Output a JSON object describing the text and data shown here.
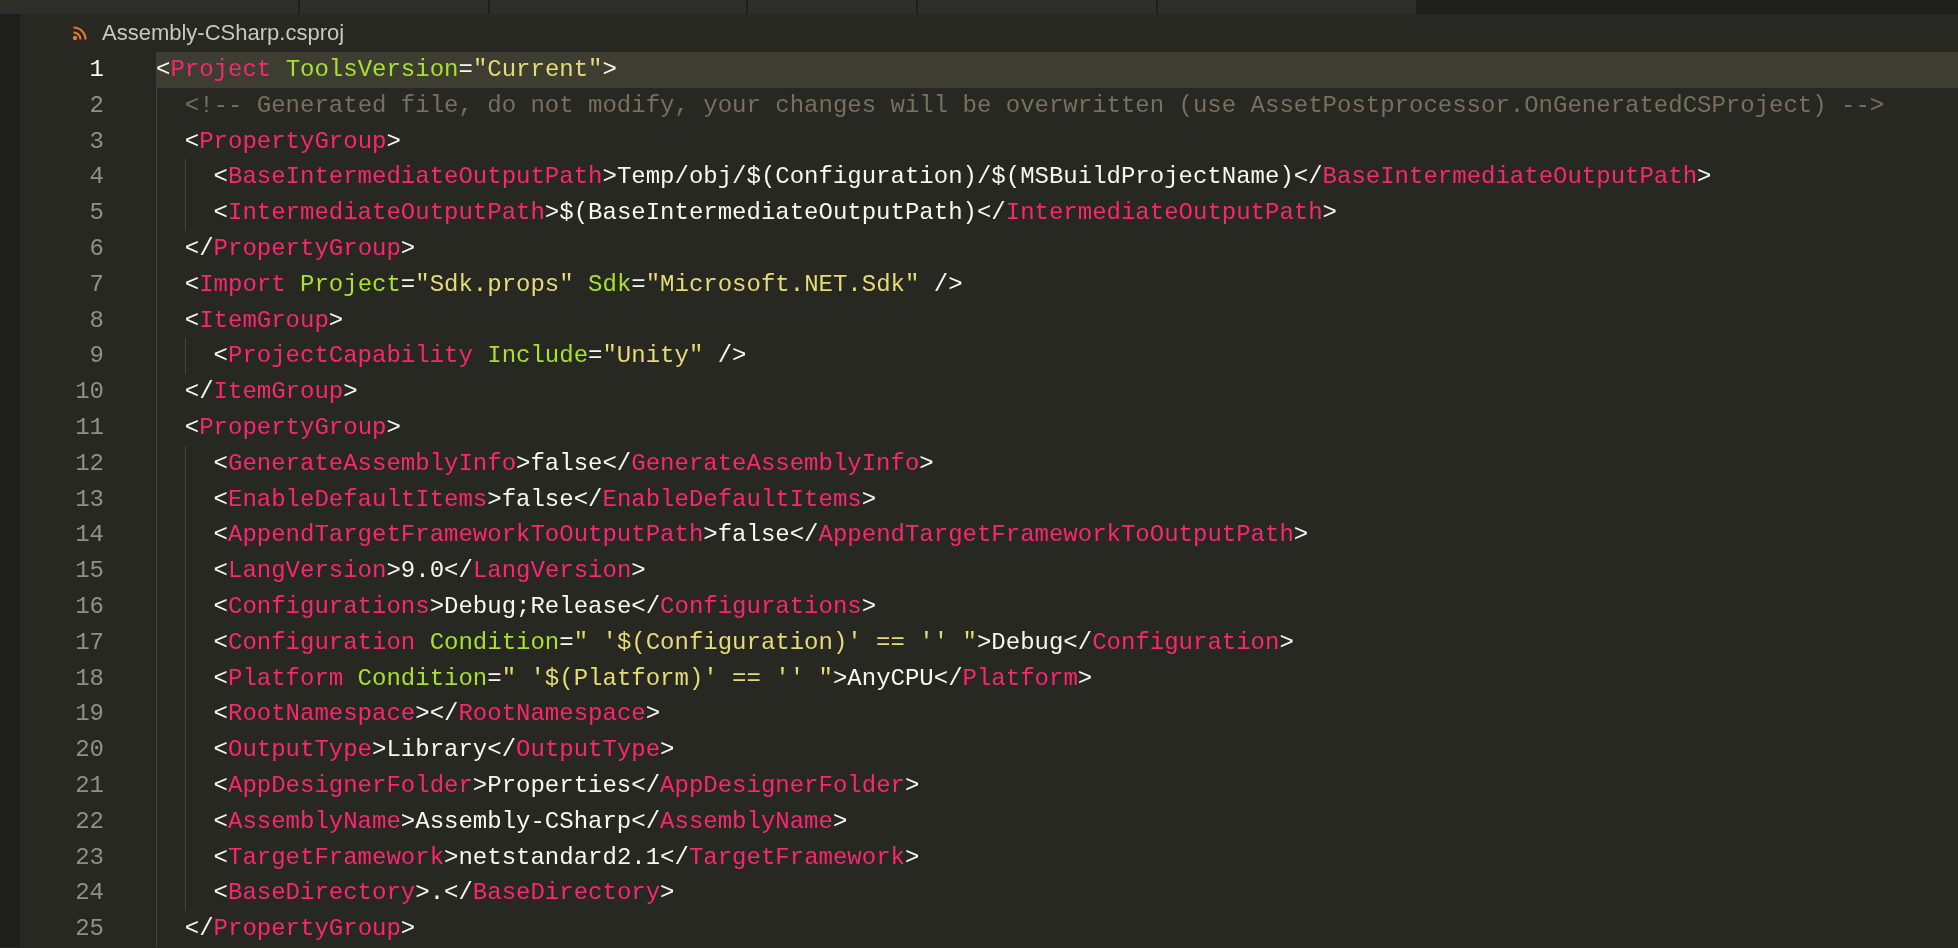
{
  "breadcrumb": {
    "file_name": "Assembly-CSharp.csproj"
  },
  "lines": [
    {
      "number": "1",
      "current": true,
      "tokens": [
        {
          "kind": "punct",
          "text": "<"
        },
        {
          "kind": "tag",
          "text": "Project"
        },
        {
          "kind": "attr",
          "text": " ToolsVersion"
        },
        {
          "kind": "punct",
          "text": "="
        },
        {
          "kind": "string",
          "text": "\"Current\""
        },
        {
          "kind": "punct",
          "text": ">"
        }
      ],
      "children": [
        {
          "number": "2",
          "current": false,
          "tokens": [
            {
              "kind": "comment",
              "text": "<!-- Generated file, do not modify, your changes will be overwritten (use AssetPostprocessor.OnGeneratedCSProject) -->"
            }
          ]
        },
        {
          "number": "3",
          "current": false,
          "tokens": [
            {
              "kind": "punct",
              "text": "<"
            },
            {
              "kind": "tag",
              "text": "PropertyGroup"
            },
            {
              "kind": "punct",
              "text": ">"
            }
          ],
          "children": [
            {
              "number": "4",
              "current": false,
              "tokens": [
                {
                  "kind": "punct",
                  "text": "<"
                },
                {
                  "kind": "tag",
                  "text": "BaseIntermediateOutputPath"
                },
                {
                  "kind": "punct",
                  "text": ">"
                },
                {
                  "kind": "text",
                  "text": "Temp/obj/$(Configuration)/$(MSBuildProjectName)"
                },
                {
                  "kind": "punct",
                  "text": "</"
                },
                {
                  "kind": "tag",
                  "text": "BaseIntermediateOutputPath"
                },
                {
                  "kind": "punct",
                  "text": ">"
                }
              ]
            },
            {
              "number": "5",
              "current": false,
              "tokens": [
                {
                  "kind": "punct",
                  "text": "<"
                },
                {
                  "kind": "tag",
                  "text": "IntermediateOutputPath"
                },
                {
                  "kind": "punct",
                  "text": ">"
                },
                {
                  "kind": "text",
                  "text": "$(BaseIntermediateOutputPath)"
                },
                {
                  "kind": "punct",
                  "text": "</"
                },
                {
                  "kind": "tag",
                  "text": "IntermediateOutputPath"
                },
                {
                  "kind": "punct",
                  "text": ">"
                }
              ]
            }
          ]
        },
        {
          "number": "6",
          "current": false,
          "tokens": [
            {
              "kind": "punct",
              "text": "</"
            },
            {
              "kind": "tag",
              "text": "PropertyGroup"
            },
            {
              "kind": "punct",
              "text": ">"
            }
          ]
        },
        {
          "number": "7",
          "current": false,
          "tokens": [
            {
              "kind": "punct",
              "text": "<"
            },
            {
              "kind": "tag",
              "text": "Import"
            },
            {
              "kind": "attr",
              "text": " Project"
            },
            {
              "kind": "punct",
              "text": "="
            },
            {
              "kind": "string",
              "text": "\"Sdk.props\""
            },
            {
              "kind": "attr",
              "text": " Sdk"
            },
            {
              "kind": "punct",
              "text": "="
            },
            {
              "kind": "string",
              "text": "\"Microsoft.NET.Sdk\""
            },
            {
              "kind": "punct",
              "text": " />"
            }
          ]
        },
        {
          "number": "8",
          "current": false,
          "tokens": [
            {
              "kind": "punct",
              "text": "<"
            },
            {
              "kind": "tag",
              "text": "ItemGroup"
            },
            {
              "kind": "punct",
              "text": ">"
            }
          ],
          "children": [
            {
              "number": "9",
              "current": false,
              "tokens": [
                {
                  "kind": "punct",
                  "text": "<"
                },
                {
                  "kind": "tag",
                  "text": "ProjectCapability"
                },
                {
                  "kind": "attr",
                  "text": " Include"
                },
                {
                  "kind": "punct",
                  "text": "="
                },
                {
                  "kind": "string",
                  "text": "\"Unity\""
                },
                {
                  "kind": "punct",
                  "text": " />"
                }
              ]
            }
          ]
        },
        {
          "number": "10",
          "current": false,
          "tokens": [
            {
              "kind": "punct",
              "text": "</"
            },
            {
              "kind": "tag",
              "text": "ItemGroup"
            },
            {
              "kind": "punct",
              "text": ">"
            }
          ]
        },
        {
          "number": "11",
          "current": false,
          "tokens": [
            {
              "kind": "punct",
              "text": "<"
            },
            {
              "kind": "tag",
              "text": "PropertyGroup"
            },
            {
              "kind": "punct",
              "text": ">"
            }
          ],
          "children": [
            {
              "number": "12",
              "current": false,
              "tokens": [
                {
                  "kind": "punct",
                  "text": "<"
                },
                {
                  "kind": "tag",
                  "text": "GenerateAssemblyInfo"
                },
                {
                  "kind": "punct",
                  "text": ">"
                },
                {
                  "kind": "text",
                  "text": "false"
                },
                {
                  "kind": "punct",
                  "text": "</"
                },
                {
                  "kind": "tag",
                  "text": "GenerateAssemblyInfo"
                },
                {
                  "kind": "punct",
                  "text": ">"
                }
              ]
            },
            {
              "number": "13",
              "current": false,
              "tokens": [
                {
                  "kind": "punct",
                  "text": "<"
                },
                {
                  "kind": "tag",
                  "text": "EnableDefaultItems"
                },
                {
                  "kind": "punct",
                  "text": ">"
                },
                {
                  "kind": "text",
                  "text": "false"
                },
                {
                  "kind": "punct",
                  "text": "</"
                },
                {
                  "kind": "tag",
                  "text": "EnableDefaultItems"
                },
                {
                  "kind": "punct",
                  "text": ">"
                }
              ]
            },
            {
              "number": "14",
              "current": false,
              "tokens": [
                {
                  "kind": "punct",
                  "text": "<"
                },
                {
                  "kind": "tag",
                  "text": "AppendTargetFrameworkToOutputPath"
                },
                {
                  "kind": "punct",
                  "text": ">"
                },
                {
                  "kind": "text",
                  "text": "false"
                },
                {
                  "kind": "punct",
                  "text": "</"
                },
                {
                  "kind": "tag",
                  "text": "AppendTargetFrameworkToOutputPath"
                },
                {
                  "kind": "punct",
                  "text": ">"
                }
              ]
            },
            {
              "number": "15",
              "current": false,
              "tokens": [
                {
                  "kind": "punct",
                  "text": "<"
                },
                {
                  "kind": "tag",
                  "text": "LangVersion"
                },
                {
                  "kind": "punct",
                  "text": ">"
                },
                {
                  "kind": "text",
                  "text": "9.0"
                },
                {
                  "kind": "punct",
                  "text": "</"
                },
                {
                  "kind": "tag",
                  "text": "LangVersion"
                },
                {
                  "kind": "punct",
                  "text": ">"
                }
              ]
            },
            {
              "number": "16",
              "current": false,
              "tokens": [
                {
                  "kind": "punct",
                  "text": "<"
                },
                {
                  "kind": "tag",
                  "text": "Configurations"
                },
                {
                  "kind": "punct",
                  "text": ">"
                },
                {
                  "kind": "text",
                  "text": "Debug;Release"
                },
                {
                  "kind": "punct",
                  "text": "</"
                },
                {
                  "kind": "tag",
                  "text": "Configurations"
                },
                {
                  "kind": "punct",
                  "text": ">"
                }
              ]
            },
            {
              "number": "17",
              "current": false,
              "tokens": [
                {
                  "kind": "punct",
                  "text": "<"
                },
                {
                  "kind": "tag",
                  "text": "Configuration"
                },
                {
                  "kind": "attr",
                  "text": " Condition"
                },
                {
                  "kind": "punct",
                  "text": "="
                },
                {
                  "kind": "string",
                  "text": "\" '$(Configuration)' == '' \""
                },
                {
                  "kind": "punct",
                  "text": ">"
                },
                {
                  "kind": "text",
                  "text": "Debug"
                },
                {
                  "kind": "punct",
                  "text": "</"
                },
                {
                  "kind": "tag",
                  "text": "Configuration"
                },
                {
                  "kind": "punct",
                  "text": ">"
                }
              ]
            },
            {
              "number": "18",
              "current": false,
              "tokens": [
                {
                  "kind": "punct",
                  "text": "<"
                },
                {
                  "kind": "tag",
                  "text": "Platform"
                },
                {
                  "kind": "attr",
                  "text": " Condition"
                },
                {
                  "kind": "punct",
                  "text": "="
                },
                {
                  "kind": "string",
                  "text": "\" '$(Platform)' == '' \""
                },
                {
                  "kind": "punct",
                  "text": ">"
                },
                {
                  "kind": "text",
                  "text": "AnyCPU"
                },
                {
                  "kind": "punct",
                  "text": "</"
                },
                {
                  "kind": "tag",
                  "text": "Platform"
                },
                {
                  "kind": "punct",
                  "text": ">"
                }
              ]
            },
            {
              "number": "19",
              "current": false,
              "tokens": [
                {
                  "kind": "punct",
                  "text": "<"
                },
                {
                  "kind": "tag",
                  "text": "RootNamespace"
                },
                {
                  "kind": "punct",
                  "text": "></"
                },
                {
                  "kind": "tag",
                  "text": "RootNamespace"
                },
                {
                  "kind": "punct",
                  "text": ">"
                }
              ]
            },
            {
              "number": "20",
              "current": false,
              "tokens": [
                {
                  "kind": "punct",
                  "text": "<"
                },
                {
                  "kind": "tag",
                  "text": "OutputType"
                },
                {
                  "kind": "punct",
                  "text": ">"
                },
                {
                  "kind": "text",
                  "text": "Library"
                },
                {
                  "kind": "punct",
                  "text": "</"
                },
                {
                  "kind": "tag",
                  "text": "OutputType"
                },
                {
                  "kind": "punct",
                  "text": ">"
                }
              ]
            },
            {
              "number": "21",
              "current": false,
              "tokens": [
                {
                  "kind": "punct",
                  "text": "<"
                },
                {
                  "kind": "tag",
                  "text": "AppDesignerFolder"
                },
                {
                  "kind": "punct",
                  "text": ">"
                },
                {
                  "kind": "text",
                  "text": "Properties"
                },
                {
                  "kind": "punct",
                  "text": "</"
                },
                {
                  "kind": "tag",
                  "text": "AppDesignerFolder"
                },
                {
                  "kind": "punct",
                  "text": ">"
                }
              ]
            },
            {
              "number": "22",
              "current": false,
              "tokens": [
                {
                  "kind": "punct",
                  "text": "<"
                },
                {
                  "kind": "tag",
                  "text": "AssemblyName"
                },
                {
                  "kind": "punct",
                  "text": ">"
                },
                {
                  "kind": "text",
                  "text": "Assembly-CSharp"
                },
                {
                  "kind": "punct",
                  "text": "</"
                },
                {
                  "kind": "tag",
                  "text": "AssemblyName"
                },
                {
                  "kind": "punct",
                  "text": ">"
                }
              ]
            },
            {
              "number": "23",
              "current": false,
              "tokens": [
                {
                  "kind": "punct",
                  "text": "<"
                },
                {
                  "kind": "tag",
                  "text": "TargetFramework"
                },
                {
                  "kind": "punct",
                  "text": ">"
                },
                {
                  "kind": "text",
                  "text": "netstandard2.1"
                },
                {
                  "kind": "punct",
                  "text": "</"
                },
                {
                  "kind": "tag",
                  "text": "TargetFramework"
                },
                {
                  "kind": "punct",
                  "text": ">"
                }
              ]
            },
            {
              "number": "24",
              "current": false,
              "tokens": [
                {
                  "kind": "punct",
                  "text": "<"
                },
                {
                  "kind": "tag",
                  "text": "BaseDirectory"
                },
                {
                  "kind": "punct",
                  "text": ">"
                },
                {
                  "kind": "text",
                  "text": "."
                },
                {
                  "kind": "punct",
                  "text": "</"
                },
                {
                  "kind": "tag",
                  "text": "BaseDirectory"
                },
                {
                  "kind": "punct",
                  "text": ">"
                }
              ]
            }
          ]
        },
        {
          "number": "25",
          "current": false,
          "tokens": [
            {
              "kind": "punct",
              "text": "</"
            },
            {
              "kind": "tag",
              "text": "PropertyGroup"
            },
            {
              "kind": "punct",
              "text": ">"
            }
          ]
        }
      ]
    }
  ]
}
